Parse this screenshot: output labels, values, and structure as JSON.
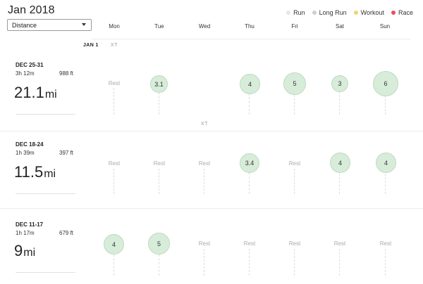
{
  "header": {
    "title": "Jan 2018",
    "metric_select": {
      "value": "Distance",
      "icon": "chevron-down-icon"
    },
    "legend": [
      {
        "label": "Run",
        "color": "#e6e6e6"
      },
      {
        "label": "Long Run",
        "color": "#cfcfcf"
      },
      {
        "label": "Workout",
        "color": "#f2d36f"
      },
      {
        "label": "Race",
        "color": "#e8505b"
      }
    ],
    "days": [
      "Mon",
      "Tue",
      "Wed",
      "Thu",
      "Fri",
      "Sat",
      "Sun"
    ]
  },
  "markers": {
    "month_label": "JAN 1",
    "xt_labels": [
      "XT",
      "XT"
    ]
  },
  "weeks": [
    {
      "dates": "DEC 25-31",
      "time": "3h 12m",
      "elevation": "988 ft",
      "distance": "21.1",
      "unit": "mi",
      "days": [
        "Rest",
        "3.1",
        null,
        "4",
        "5",
        "3",
        "6"
      ]
    },
    {
      "dates": "DEC 18-24",
      "time": "1h 39m",
      "elevation": "397 ft",
      "distance": "11.5",
      "unit": "mi",
      "days": [
        "Rest",
        "Rest",
        "Rest",
        "3.4",
        "Rest",
        "4",
        "4"
      ]
    },
    {
      "dates": "DEC 11-17",
      "time": "1h 17m",
      "elevation": "679 ft",
      "distance": "9",
      "unit": "mi",
      "days": [
        "4",
        "5",
        "Rest",
        "Rest",
        "Rest",
        "Rest",
        "Rest"
      ]
    }
  ]
}
